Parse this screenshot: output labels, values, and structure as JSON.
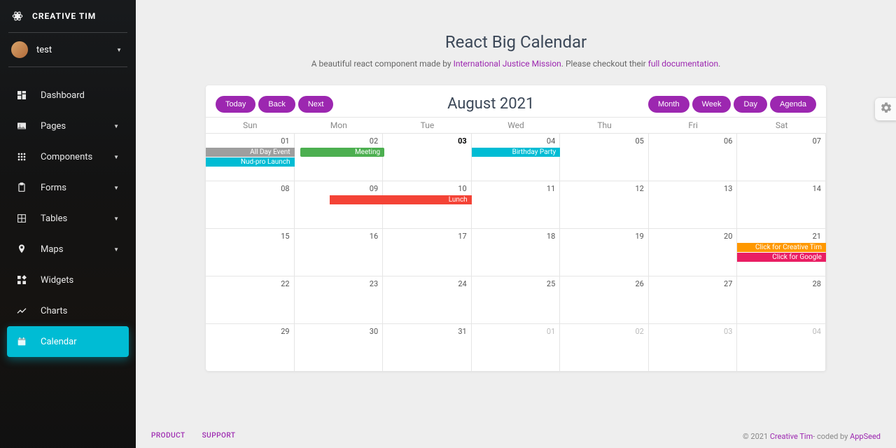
{
  "brand": {
    "name": "CREATIVE TIM"
  },
  "user": {
    "name": "test"
  },
  "sidebar": {
    "items": [
      {
        "label": "Dashboard",
        "icon": "dashboard",
        "caret": false
      },
      {
        "label": "Pages",
        "icon": "image",
        "caret": true
      },
      {
        "label": "Components",
        "icon": "apps",
        "caret": true
      },
      {
        "label": "Forms",
        "icon": "clipboard",
        "caret": true
      },
      {
        "label": "Tables",
        "icon": "grid",
        "caret": true
      },
      {
        "label": "Maps",
        "icon": "pin",
        "caret": true
      },
      {
        "label": "Widgets",
        "icon": "widgets",
        "caret": false
      },
      {
        "label": "Charts",
        "icon": "chart",
        "caret": false
      },
      {
        "label": "Calendar",
        "icon": "calendar",
        "caret": false,
        "active": true
      }
    ]
  },
  "page": {
    "title": "React Big Calendar",
    "subtitle_pre": "A beautiful react component made by ",
    "subtitle_link1": "International Justice Mission",
    "subtitle_mid": ". Please checkout their ",
    "subtitle_link2": "full documentation",
    "subtitle_post": "."
  },
  "toolbar": {
    "nav": {
      "today": "Today",
      "back": "Back",
      "next": "Next"
    },
    "title": "August 2021",
    "views": {
      "month": "Month",
      "week": "Week",
      "day": "Day",
      "agenda": "Agenda"
    }
  },
  "calendar": {
    "dow": [
      "Sun",
      "Mon",
      "Tue",
      "Wed",
      "Thu",
      "Fri",
      "Sat"
    ],
    "weeks": [
      {
        "days": [
          {
            "n": "01"
          },
          {
            "n": "02"
          },
          {
            "n": "03",
            "today": true
          },
          {
            "n": "04"
          },
          {
            "n": "05"
          },
          {
            "n": "06"
          },
          {
            "n": "07"
          }
        ],
        "events": [
          {
            "label": "All Day Event",
            "color": "gray",
            "colStart": 1,
            "colSpan": 1,
            "row": 0
          },
          {
            "label": "Meeting",
            "color": "green",
            "colStart": 2,
            "colSpan": 1,
            "row": 0
          },
          {
            "label": "Nud-pro Launch",
            "color": "cyan",
            "colStart": 1,
            "colSpan": 1,
            "row": 1
          },
          {
            "label": "Birthday Party",
            "color": "cyan",
            "colStart": 4,
            "colSpan": 1,
            "row": 0
          }
        ]
      },
      {
        "days": [
          {
            "n": "08"
          },
          {
            "n": "09"
          },
          {
            "n": "10"
          },
          {
            "n": "11"
          },
          {
            "n": "12"
          },
          {
            "n": "13"
          },
          {
            "n": "14"
          }
        ],
        "events": [
          {
            "label": "Lunch",
            "color": "red",
            "colStart": 3,
            "colSpan": 1,
            "row": 0,
            "extendLeft": true
          }
        ]
      },
      {
        "days": [
          {
            "n": "15"
          },
          {
            "n": "16"
          },
          {
            "n": "17"
          },
          {
            "n": "18"
          },
          {
            "n": "19"
          },
          {
            "n": "20"
          },
          {
            "n": "21"
          }
        ],
        "events": [
          {
            "label": "Click for Creative Tim",
            "color": "orange",
            "colStart": 7,
            "colSpan": 1,
            "row": 0
          },
          {
            "label": "Click for Google",
            "color": "pink",
            "colStart": 7,
            "colSpan": 1,
            "row": 1
          }
        ]
      },
      {
        "days": [
          {
            "n": "22"
          },
          {
            "n": "23"
          },
          {
            "n": "24"
          },
          {
            "n": "25"
          },
          {
            "n": "26"
          },
          {
            "n": "27"
          },
          {
            "n": "28"
          }
        ],
        "events": []
      },
      {
        "days": [
          {
            "n": "29"
          },
          {
            "n": "30"
          },
          {
            "n": "31"
          },
          {
            "n": "01",
            "other": true
          },
          {
            "n": "02",
            "other": true
          },
          {
            "n": "03",
            "other": true
          },
          {
            "n": "04",
            "other": true
          }
        ],
        "events": []
      }
    ]
  },
  "footer": {
    "left": [
      "PRODUCT",
      "SUPPORT"
    ],
    "right_pre": "© 2021 ",
    "right_link1": "Creative Tim",
    "right_mid": "- coded by ",
    "right_link2": "AppSeed"
  }
}
